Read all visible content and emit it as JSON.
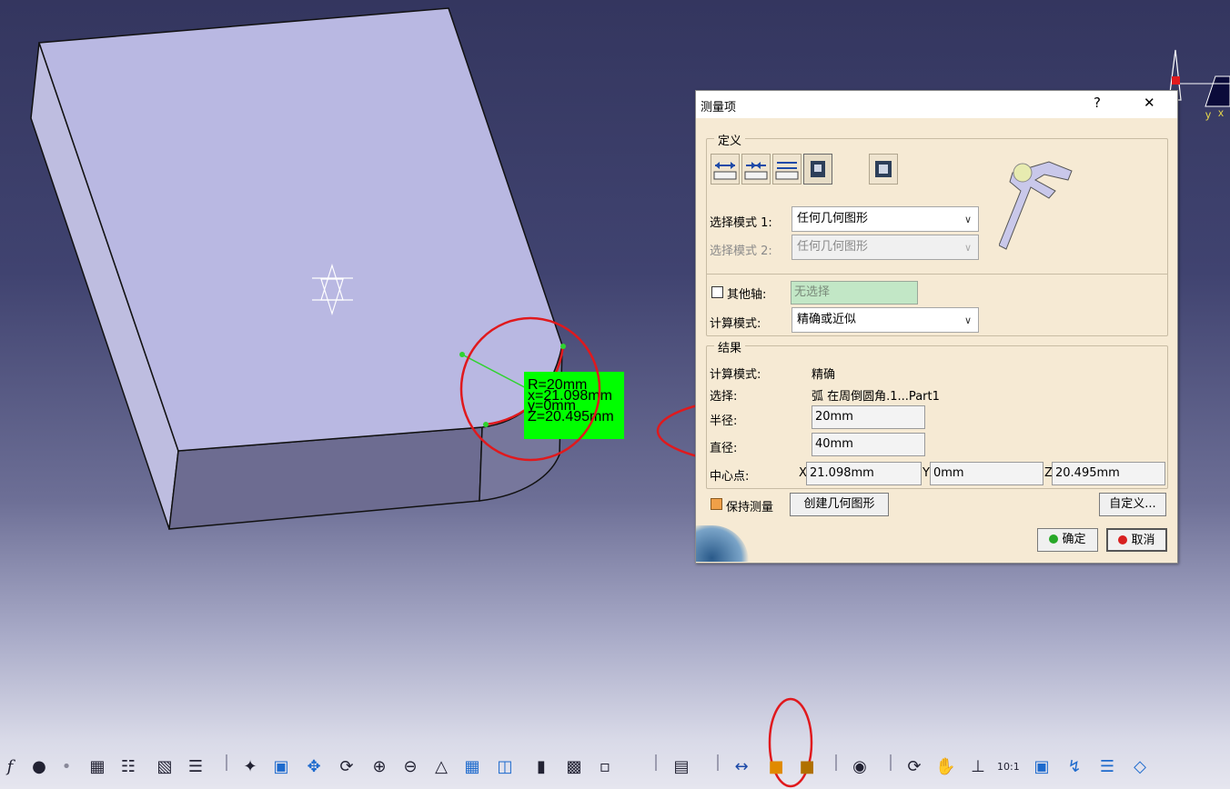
{
  "viewport": {
    "measure_label": {
      "line1": "R=20mm",
      "line2": "x=21.098mm",
      "line3": "y=0mm",
      "line4": "Z=20.495mm"
    },
    "axis_labels": {
      "y": "y",
      "x": "x"
    }
  },
  "dialog": {
    "title": "测量项",
    "help_label": "?",
    "close_label": "✕",
    "definition_group": "定义",
    "select_mode_1_label": "选择模式 1:",
    "select_mode_1_value": "任何几何图形",
    "select_mode_2_label": "选择模式 2:",
    "select_mode_2_value": "任何几何图形",
    "other_axis_label": "其他轴:",
    "other_axis_value": "无选择",
    "calc_mode_label": "计算模式:",
    "calc_mode_value": "精确或近似",
    "result_group": "结果",
    "result_calc_mode_label": "计算模式:",
    "result_calc_mode_value": "精确",
    "selection_label": "选择:",
    "selection_value": "弧 在周倒圆角.1...Part1",
    "radius_label": "半径:",
    "radius_value": "20mm",
    "diameter_label": "直径:",
    "diameter_value": "40mm",
    "center_label": "中心点:",
    "center_x_prefix": "X",
    "center_x": "21.098mm",
    "center_y_prefix": "Y",
    "center_y": "0mm",
    "center_z_prefix": "Z",
    "center_z": "20.495mm",
    "keep_measure_label": "保持测量",
    "create_geometry_label": "创建几何图形",
    "customize_label": "自定义...",
    "ok_label": "确定",
    "cancel_label": "取消"
  },
  "colors": {
    "dialog_bg": "#f6ead4",
    "annotation_red": "#e0191d",
    "label_green": "#00ff00",
    "part_face": "#b9b8e2"
  }
}
